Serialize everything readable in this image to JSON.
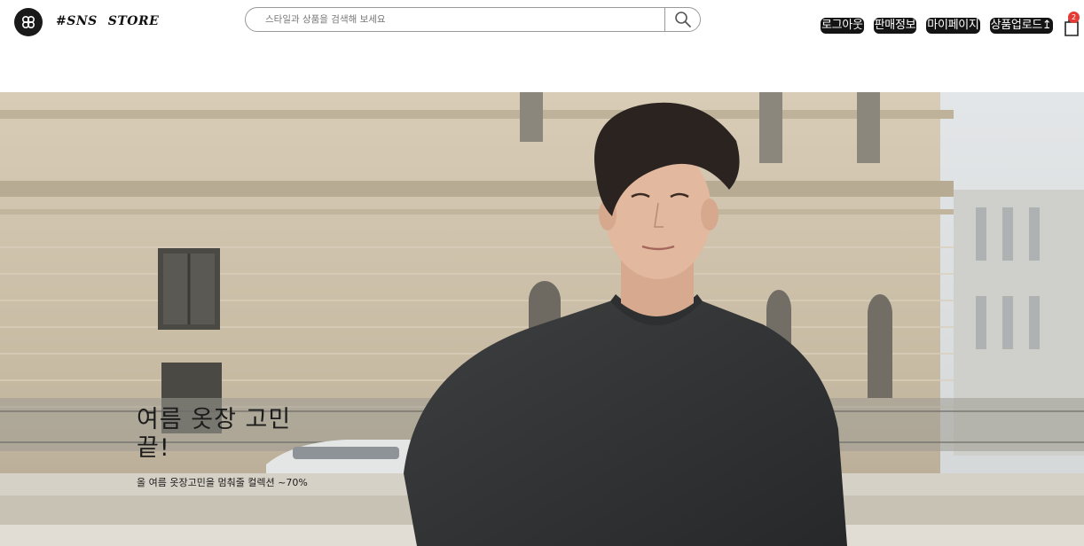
{
  "header": {
    "brand_part1": "#SNS",
    "brand_part2": "STORE",
    "logo_icon": "infinity-logo-icon",
    "search": {
      "placeholder": "스타일과 상품을 검색해 보세요",
      "value": "",
      "button_icon": "search-icon"
    },
    "nav": {
      "logout_label": "로그아웃",
      "sales_info_label": "판매정보",
      "mypage_label": "마이페이지",
      "upload_label": "상품업로드↥"
    },
    "cart": {
      "icon": "shopping-bag-icon",
      "count": "2"
    }
  },
  "hero": {
    "title": "여름 옷장 고민 끝!",
    "subtitle": "올 여름 옷장고민을 멈춰줄 컬렉션 ~70%",
    "image": "banner-photo-man-in-black-tshirt"
  },
  "colors": {
    "nav_button_bg": "#141414",
    "nav_button_text": "#ffffff",
    "badge": "#e53935",
    "building": "#c9bca6"
  }
}
